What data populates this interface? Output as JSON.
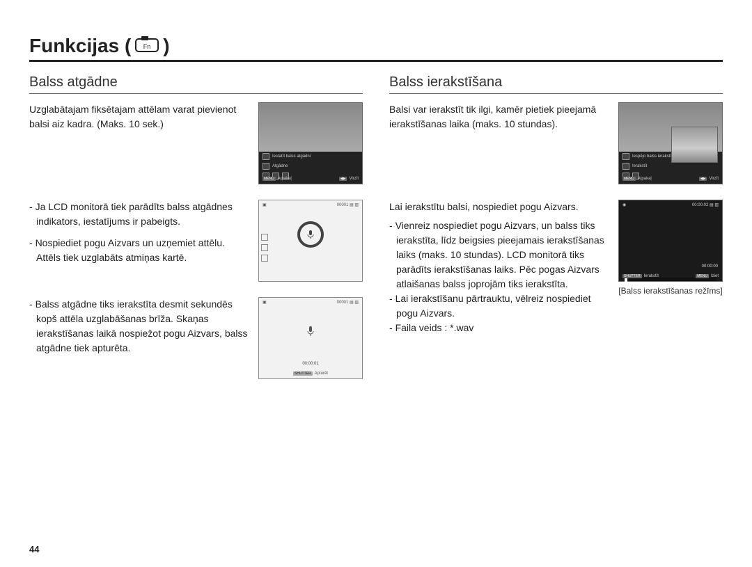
{
  "page_number": "44",
  "title": "Funkcijas (",
  "title_close": ")",
  "left": {
    "heading": "Balss atgādne",
    "intro": "Uzglabātajam fiksētajam attēlam varat pievienot balsi aiz kadra. (Maks. 10 sek.)",
    "block1_a": "Ja LCD monitorā tiek parādīts balss atgādnes indikators, iestatījums ir pabeigts.",
    "block1_b": "Nospiediet pogu Aizvars un uzņemiet attēlu. Attēls tiek uzglabāts atmiņas kartē.",
    "block2": "Balss atgādne tiks ierakstīta desmit sekundēs kopš attēla uzglabāšanas brīža. Skaņas ierakstīšanas laikā nospiežot pogu Aizvars, balss atgādne tiek apturēta."
  },
  "right": {
    "heading": "Balss ierakstīšana",
    "intro": "Balsi var ierakstīt tik ilgi, kamēr pietiek pieejamā ierakstīšanas laika (maks. 10 stundas).",
    "lead": "Lai ierakstītu balsi, nospiediet pogu Aizvars.",
    "b1": "Vienreiz nospiediet pogu Aizvars, un balss tiks ierakstīta, līdz beigsies pieejamais ierakstīšanas laiks (maks. 10 stundas). LCD monitorā tiks parādīts ierakstīšanas laiks. Pēc pogas Aizvars atlaišanas balss joprojām tiks ierakstīta.",
    "b2": "Lai ierakstīšanu pārtrauktu, vēlreiz nospiediet pogu Aizvars.",
    "b3": "Faila veids : *.wav",
    "mode_caption": "[Balss ierakstīšanas režīms]"
  },
  "lcd": {
    "menu1_opt1": "Iestatīt balss atgādni",
    "menu1_opt2": "Atgādne",
    "menu2_opt1": "Iespējo balss ierakstīšanu.",
    "menu2_opt2": "Ierakstīt",
    "back": "Atpakaļ",
    "move": "Virzīt",
    "shutter": "SHUTTER",
    "menu_btn": "MENU",
    "stop": "Apturēt",
    "record": "Ierakstīt",
    "exit": "Iziet",
    "counter1": "00001",
    "timer1": "00:00:01",
    "timer0": "00:00:00",
    "topclock": "00:00:02"
  }
}
